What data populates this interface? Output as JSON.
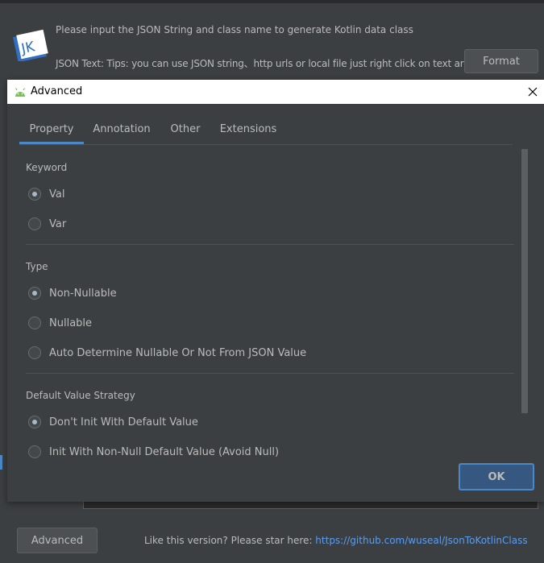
{
  "main": {
    "prompt": "Please input the JSON String and class name to generate Kotlin data class",
    "json_label": "JSON Text: Tips: you can use JSON string、http urls or local file just right click on text area",
    "format_label": "Format",
    "advanced_label": "Advanced",
    "star_prefix": "Like this version? Please star here: ",
    "star_link": "https://github.com/wuseal/JsonToKotlinClass",
    "logo_text": "JK",
    "accent": "#4a88c7"
  },
  "dialog": {
    "title": "Advanced",
    "tabs": [
      {
        "label": "Property"
      },
      {
        "label": "Annotation"
      },
      {
        "label": "Other"
      },
      {
        "label": "Extensions"
      }
    ],
    "active_tab": "Property",
    "sections": {
      "keyword": {
        "label": "Keyword",
        "options": [
          {
            "label": "Val",
            "checked": true
          },
          {
            "label": "Var",
            "checked": false
          }
        ]
      },
      "type": {
        "label": "Type",
        "options": [
          {
            "label": "Non-Nullable",
            "checked": true
          },
          {
            "label": "Nullable",
            "checked": false
          },
          {
            "label": "Auto Determine Nullable Or Not From JSON Value",
            "checked": false
          }
        ]
      },
      "default_value": {
        "label": "Default Value Strategy",
        "options": [
          {
            "label": "Don't Init With Default Value",
            "checked": true
          },
          {
            "label": "Init With Non-Null Default Value (Avoid Null)",
            "checked": false
          }
        ]
      }
    },
    "ok_label": "OK",
    "close_icon": "close-icon",
    "title_icon": "android-icon"
  }
}
